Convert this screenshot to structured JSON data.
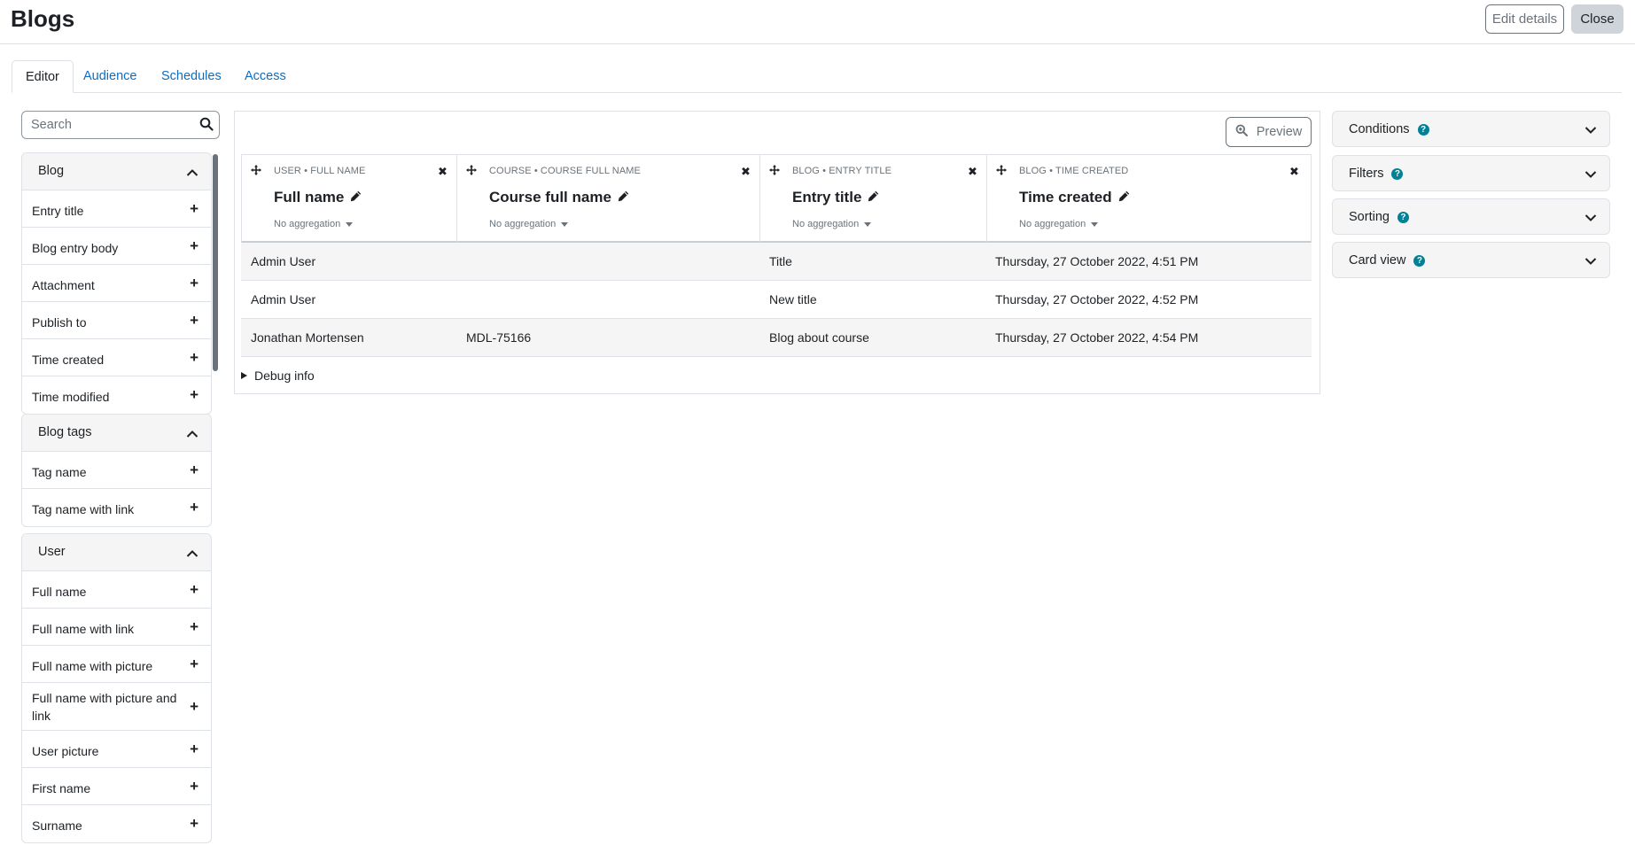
{
  "header": {
    "title": "Blogs",
    "edit_details_label": "Edit details",
    "close_label": "Close"
  },
  "tabs": [
    {
      "label": "Editor",
      "active": true
    },
    {
      "label": "Audience",
      "active": false
    },
    {
      "label": "Schedules",
      "active": false
    },
    {
      "label": "Access",
      "active": false
    }
  ],
  "sidebar": {
    "search_placeholder": "Search",
    "groups": [
      {
        "title": "Blog",
        "items": [
          "Entry title",
          "Blog entry body",
          "Attachment",
          "Publish to",
          "Time created",
          "Time modified"
        ]
      },
      {
        "title": "Blog tags",
        "items": [
          "Tag name",
          "Tag name with link"
        ]
      },
      {
        "title": "User",
        "items": [
          "Full name",
          "Full name with link",
          "Full name with picture",
          "Full name with picture and link",
          "User picture",
          "First name",
          "Surname"
        ]
      }
    ]
  },
  "report": {
    "preview_label": "Preview",
    "columns": [
      {
        "source": "User • Full name",
        "title": "Full name",
        "aggregation": "No aggregation"
      },
      {
        "source": "Course • Course full name",
        "title": "Course full name",
        "aggregation": "No aggregation"
      },
      {
        "source": "Blog • Entry title",
        "title": "Entry title",
        "aggregation": "No aggregation"
      },
      {
        "source": "Blog • Time created",
        "title": "Time created",
        "aggregation": "No aggregation"
      }
    ],
    "rows": [
      [
        "Admin User",
        "",
        "Title",
        "Thursday, 27 October 2022, 4:51 PM"
      ],
      [
        "Admin User",
        "",
        "New title",
        "Thursday, 27 October 2022, 4:52 PM"
      ],
      [
        "Jonathan Mortensen",
        "MDL-75166",
        "Blog about course",
        "Thursday, 27 October 2022, 4:54 PM"
      ]
    ],
    "debug_label": "Debug info"
  },
  "settings_panels": [
    {
      "label": "Conditions"
    },
    {
      "label": "Filters"
    },
    {
      "label": "Sorting"
    },
    {
      "label": "Card view"
    }
  ],
  "colors": {
    "link": "#0f6cbf",
    "help_icon": "#008196",
    "header_bg": "#f5f5f5",
    "border": "#dee2e6"
  },
  "icons": {
    "search": "search-icon",
    "chevron_up": "chevron-up-icon",
    "chevron_down": "chevron-down-icon",
    "plus": "plus-icon",
    "move": "move-icon",
    "remove": "close-icon",
    "edit": "pencil-icon",
    "preview": "zoom-icon",
    "help": "help-icon"
  }
}
